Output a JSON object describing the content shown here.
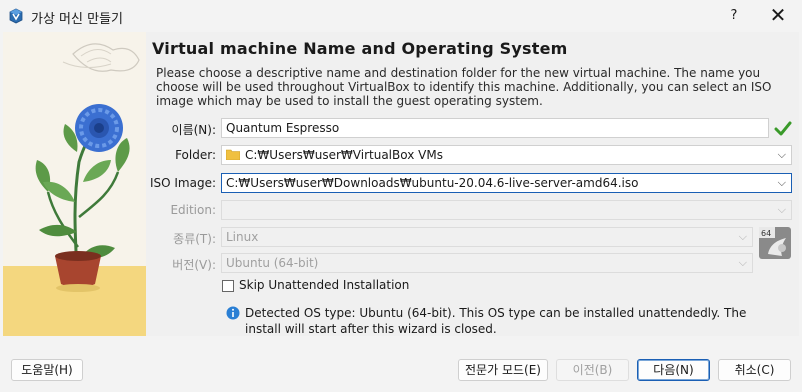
{
  "window": {
    "title": "가상 머신 만들기",
    "help_label": "?",
    "close_label": "✕"
  },
  "heading": "Virtual machine Name and Operating System",
  "description": "Please choose a descriptive name and destination folder for the new virtual machine. The name you choose will be used throughout VirtualBox to identify this machine. Additionally, you can select an ISO image which may be used to install the guest operating system.",
  "form": {
    "name": {
      "label": "이름(N):",
      "value": "Quantum Espresso"
    },
    "folder": {
      "label": "Folder:",
      "value": "C:₩Users₩user₩VirtualBox VMs"
    },
    "iso": {
      "label": "ISO Image:",
      "value": "C:₩Users₩user₩Downloads₩ubuntu-20.04.6-live-server-amd64.iso"
    },
    "edition": {
      "label": "Edition:",
      "value": ""
    },
    "type": {
      "label": "종류(T):",
      "value": "Linux"
    },
    "version": {
      "label": "버전(V):",
      "value": "Ubuntu (64-bit)"
    }
  },
  "os_badge": "64",
  "skip_unattended": {
    "label": "Skip Unattended Installation",
    "checked": false
  },
  "info": "Detected OS type: Ubuntu (64-bit). This OS type can be installed unattendedly. The install will start after this wizard is closed.",
  "buttons": {
    "help": "도움말(H)",
    "expert": "전문가 모드(E)",
    "back": "이전(B)",
    "next": "다음(N)",
    "cancel": "취소(C)"
  },
  "colors": {
    "accent": "#1a5fb4",
    "check_green": "#3a9a2a",
    "info_blue": "#2a7fd4",
    "folder_yellow": "#f0c040"
  }
}
